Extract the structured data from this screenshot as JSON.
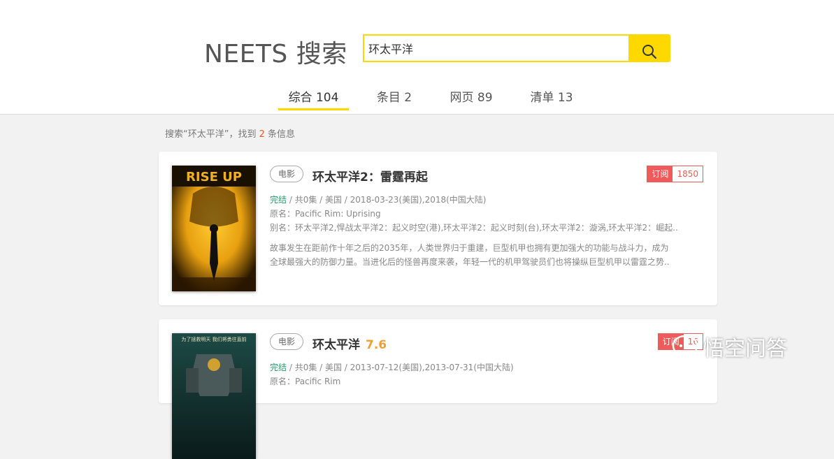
{
  "brand": {
    "text": "NEETS 搜索"
  },
  "search": {
    "value": "环太平洋",
    "button_icon": "search-icon"
  },
  "tabs": [
    {
      "label": "综合 104",
      "active": true
    },
    {
      "label": "条目 2",
      "active": false
    },
    {
      "label": "网页 89",
      "active": false
    },
    {
      "label": "清单 13",
      "active": false
    }
  ],
  "result_info": {
    "prefix": "搜索“环太平洋”，找到 ",
    "count": "2",
    "suffix": " 条信息"
  },
  "results": [
    {
      "tag": "电影",
      "title": "环太平洋2：雷霆再起",
      "rating": "",
      "subscribe_label": "订阅",
      "subscribe_count": "1850",
      "status": "完结",
      "info": " / 共0集 / 美国 / 2018-03-23(美国),2018(中国大陆)",
      "original_name": "原名：Pacific Rim: Uprising",
      "aliases": "别名：环太平洋2,悍战太平洋2：起义时空(港),环太平洋2：起义时刻(台),环太平洋2：漩涡,环太平洋2：崛起..",
      "desc_line1": "故事发生在距前作十年之后的2035年，人类世界归于重建，巨型机甲也拥有更加强大的功能与战斗力，成为",
      "desc_line2": "全球最强大的防御力量。当进化后的怪兽再度来袭，年轻一代的机甲驾驶员们也将操纵巨型机甲以雷霆之势..",
      "poster_text": "RISE UP"
    },
    {
      "tag": "电影",
      "title": "环太平洋",
      "rating": "7.6",
      "subscribe_label": "订阅",
      "subscribe_count": "16",
      "status": "完结",
      "info": " / 共0集 / 美国 / 2013-07-12(美国),2013-07-31(中国大陆)",
      "original_name": "原名：Pacific Rim",
      "poster_text": "为了拯救明天 我们将勇往直前"
    }
  ],
  "watermark": {
    "text": "悟空问答"
  },
  "colors": {
    "accent": "#ffd800",
    "subscribe": "#f05a5a",
    "status": "#2a9d6a",
    "rating": "#f0a030",
    "count": "#f0572b"
  }
}
